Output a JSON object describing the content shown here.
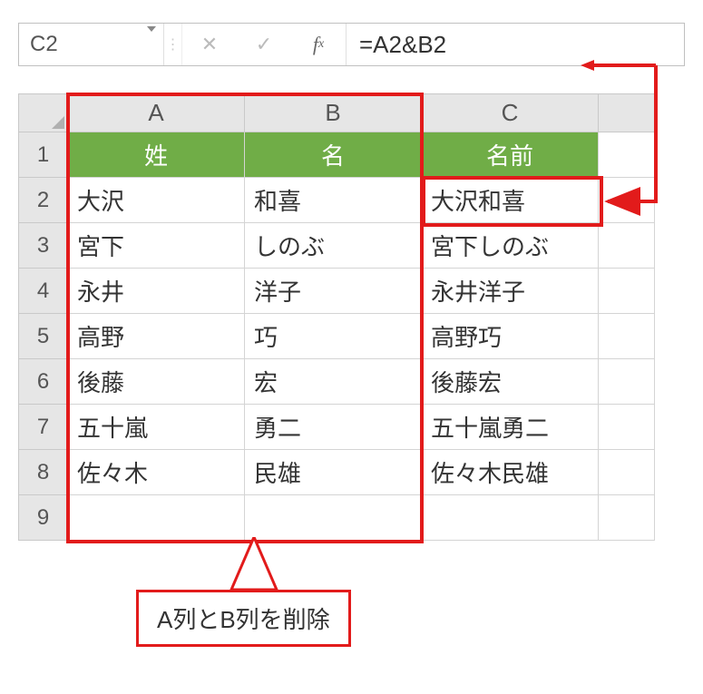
{
  "nameBox": "C2",
  "formula": "=A2&B2",
  "columns": [
    "A",
    "B",
    "C"
  ],
  "rowNums": [
    1,
    2,
    3,
    4,
    5,
    6,
    7,
    8,
    9
  ],
  "headers": {
    "A": "姓",
    "B": "名",
    "C": "名前"
  },
  "rows": [
    {
      "A": "大沢",
      "B": "和喜",
      "C": "大沢和喜"
    },
    {
      "A": "宮下",
      "B": "しのぶ",
      "C": "宮下しのぶ"
    },
    {
      "A": "永井",
      "B": "洋子",
      "C": "永井洋子"
    },
    {
      "A": "高野",
      "B": "巧",
      "C": "高野巧"
    },
    {
      "A": "後藤",
      "B": "宏",
      "C": "後藤宏"
    },
    {
      "A": "五十嵐",
      "B": "勇二",
      "C": "五十嵐勇二"
    },
    {
      "A": "佐々木",
      "B": "民雄",
      "C": "佐々木民雄"
    }
  ],
  "callout": "A列とB列を削除",
  "colors": {
    "accent": "#70AD47",
    "annotation": "#e21b1b"
  }
}
